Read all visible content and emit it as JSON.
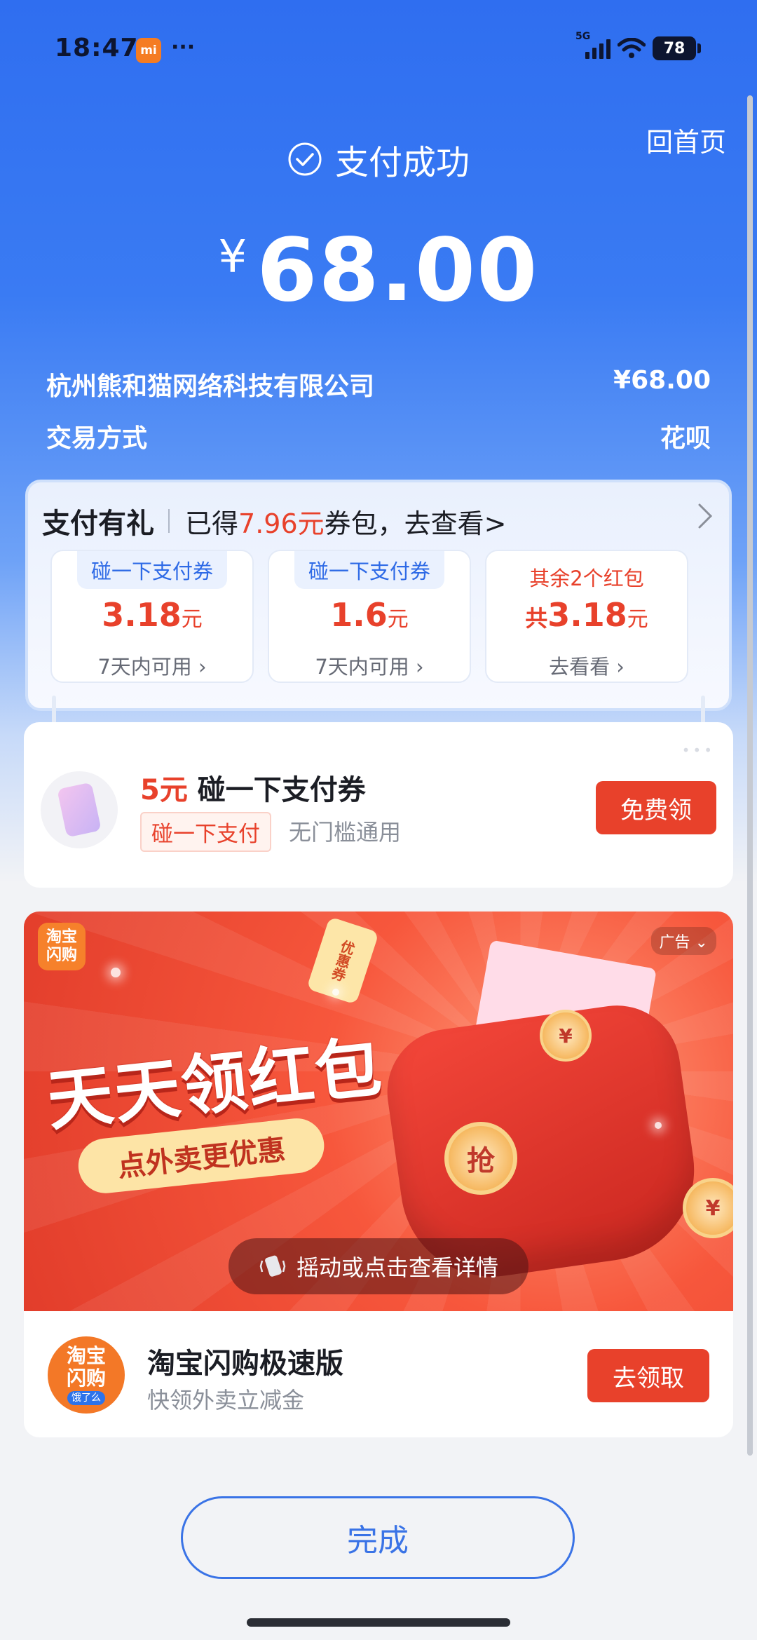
{
  "status_bar": {
    "time": "18:47",
    "mi_badge": "mi",
    "dots": "···",
    "network": "5G",
    "battery": "78"
  },
  "header": {
    "home_link": "回首页",
    "status_text": "支付成功",
    "currency_symbol": "¥",
    "amount": "68.00"
  },
  "details": {
    "merchant": "杭州熊和猫网络科技有限公司",
    "merchant_amount": "¥68.00",
    "method_label": "交易方式",
    "method_value": "花呗"
  },
  "gift": {
    "title": "支付有礼",
    "text_prefix": "已得",
    "text_highlight": "7.96元",
    "text_suffix": "券包，去查看>",
    "coupons": [
      {
        "tag": "碰一下支付券",
        "value": "3.18",
        "unit": "元",
        "note": "7天内可用"
      },
      {
        "tag": "碰一下支付券",
        "value": "1.6",
        "unit": "元",
        "note": "7天内可用"
      },
      {
        "tag": "其余2个红包",
        "prefix": "共",
        "value": "3.18",
        "unit": "元",
        "note": "去看看"
      }
    ]
  },
  "promo": {
    "amount": "5元",
    "title": "碰一下支付券",
    "tag": "碰一下支付",
    "subtitle": "无门槛通用",
    "button": "免费领"
  },
  "ad": {
    "badge_logo": "淘宝\n闪购",
    "ad_label": "广告",
    "headline": "天天领红包",
    "subline": "点外卖更优惠",
    "ribbon": "优惠券",
    "coin_char": "抢",
    "yen_char": "¥",
    "shake_text": "摇动或点击查看详情",
    "app_logo_line1": "淘宝",
    "app_logo_line2": "闪购",
    "app_logo_small": "饿了么",
    "app_name": "淘宝闪购极速版",
    "app_desc": "快领外卖立减金",
    "app_button": "去领取"
  },
  "footer": {
    "done_button": "完成"
  },
  "colors": {
    "primary_blue": "#2f6ef0",
    "accent_red": "#e8412b",
    "link_blue": "#3a73e6"
  }
}
